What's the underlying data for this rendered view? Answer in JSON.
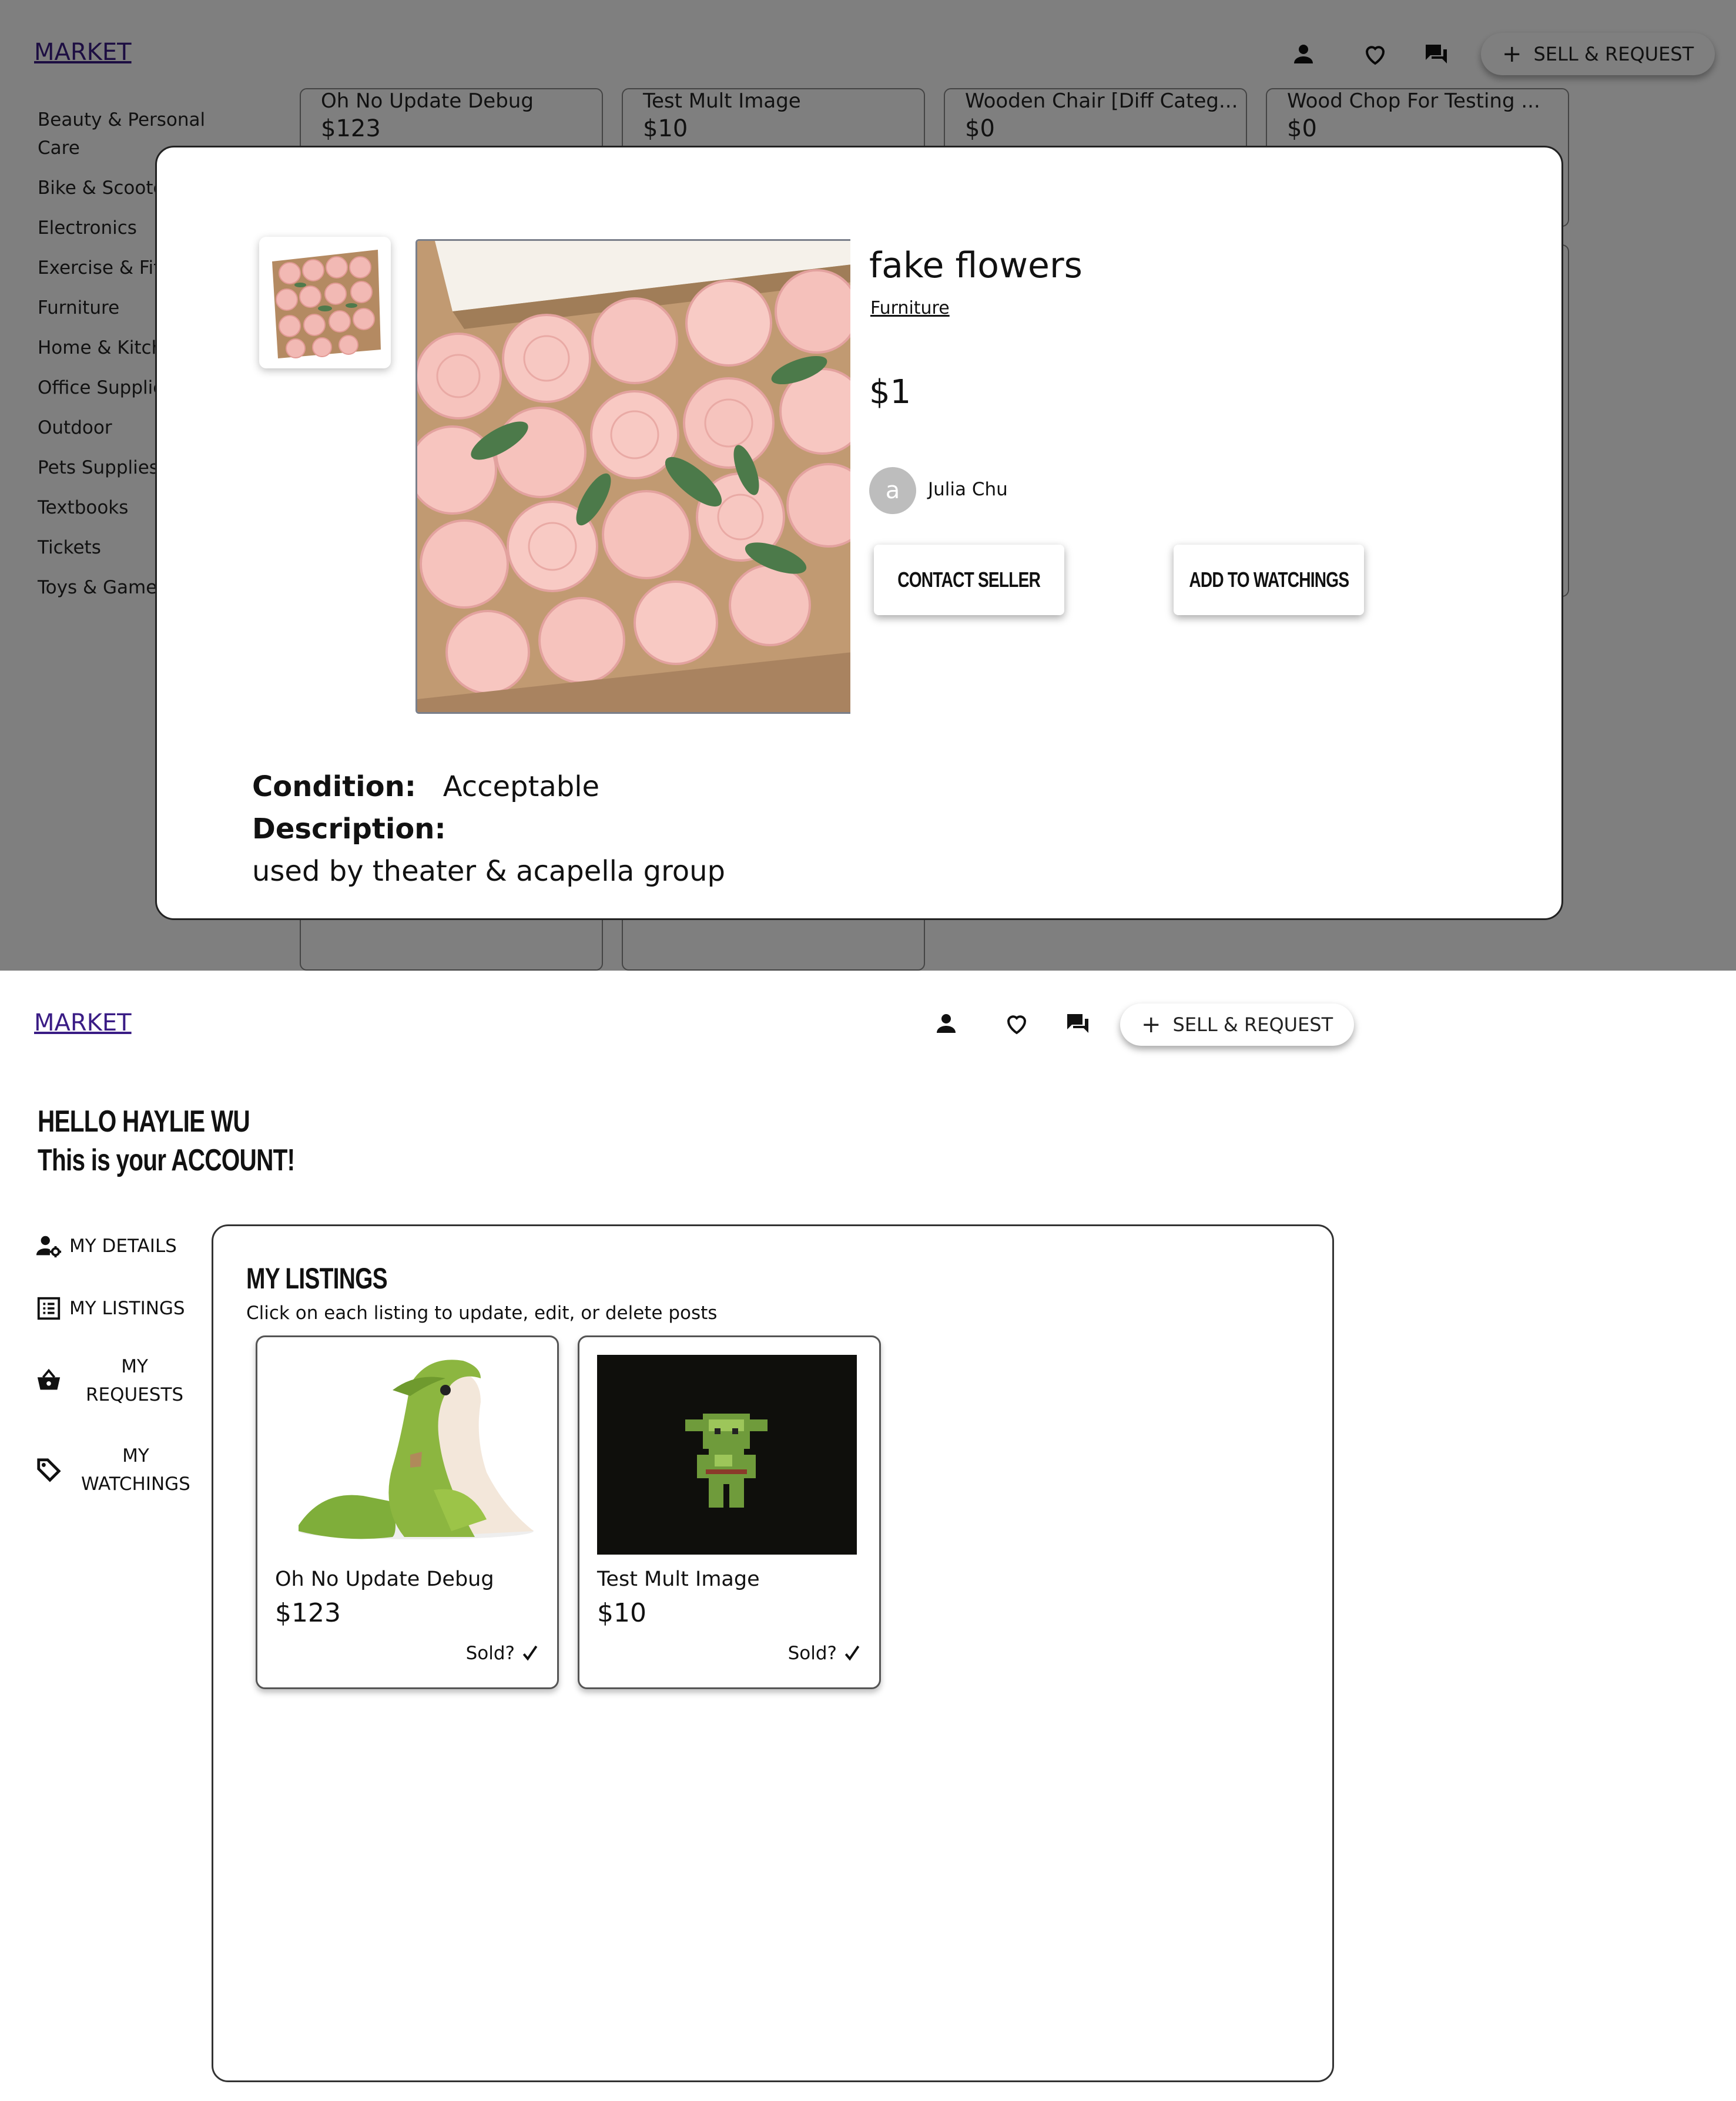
{
  "top": {
    "nav": {
      "logo": "MARKET",
      "sell_button": "SELL & REQUEST"
    },
    "categories": [
      "Beauty & Personal Care",
      "Bike & Scooter",
      "Electronics",
      "Exercise & Fitness",
      "Furniture",
      "Home & Kitchen",
      "Office Supplies",
      "Outdoor",
      "Pets Supplies",
      "Textbooks",
      "Tickets",
      "Toys & Games"
    ],
    "background_cards": [
      {
        "title": "Oh No Update Debug",
        "price": "$123"
      },
      {
        "title": "Test Mult Image",
        "price": "$10"
      },
      {
        "title": "Wooden Chair [Diff Categ...",
        "price": "$0"
      },
      {
        "title": "Wood Chop For Testing ...",
        "price": "$0"
      }
    ],
    "modal": {
      "title": "fake flowers",
      "category": "Furniture",
      "price": "$1",
      "seller_initial": "a",
      "seller_name": "Julia Chu",
      "contact_button": "CONTACT SELLER",
      "watch_button": "ADD TO WATCHINGS",
      "condition_label": "Condition:",
      "condition_value": "Acceptable",
      "description_label": "Description:",
      "description_value": "used by theater & acapella group"
    }
  },
  "bottom": {
    "nav": {
      "logo": "MARKET",
      "sell_button": "SELL & REQUEST"
    },
    "greeting_line1": "HELLO  HAYLIE WU",
    "greeting_line2": "This is your ACCOUNT!",
    "sidebar": [
      {
        "label": "MY DETAILS",
        "icon": "user-gear-icon"
      },
      {
        "label": "MY LISTINGS",
        "icon": "list-icon"
      },
      {
        "label_line1": "MY",
        "label_line2": "REQUESTS",
        "icon": "basket-icon"
      },
      {
        "label_line1": "MY",
        "label_line2": "WATCHINGS",
        "icon": "tag-icon"
      }
    ],
    "panel": {
      "title": "MY LISTINGS",
      "subtitle": "Click on each listing to update, edit, or delete posts",
      "listings": [
        {
          "title": "Oh No Update Debug",
          "price": "$123",
          "sold_label": "Sold?"
        },
        {
          "title": "Test Mult Image",
          "price": "$10",
          "sold_label": "Sold?"
        }
      ]
    }
  },
  "colors": {
    "logo": "#3a1c85",
    "overlay": "rgba(0,0,0,0.5)",
    "border": "#222222"
  }
}
